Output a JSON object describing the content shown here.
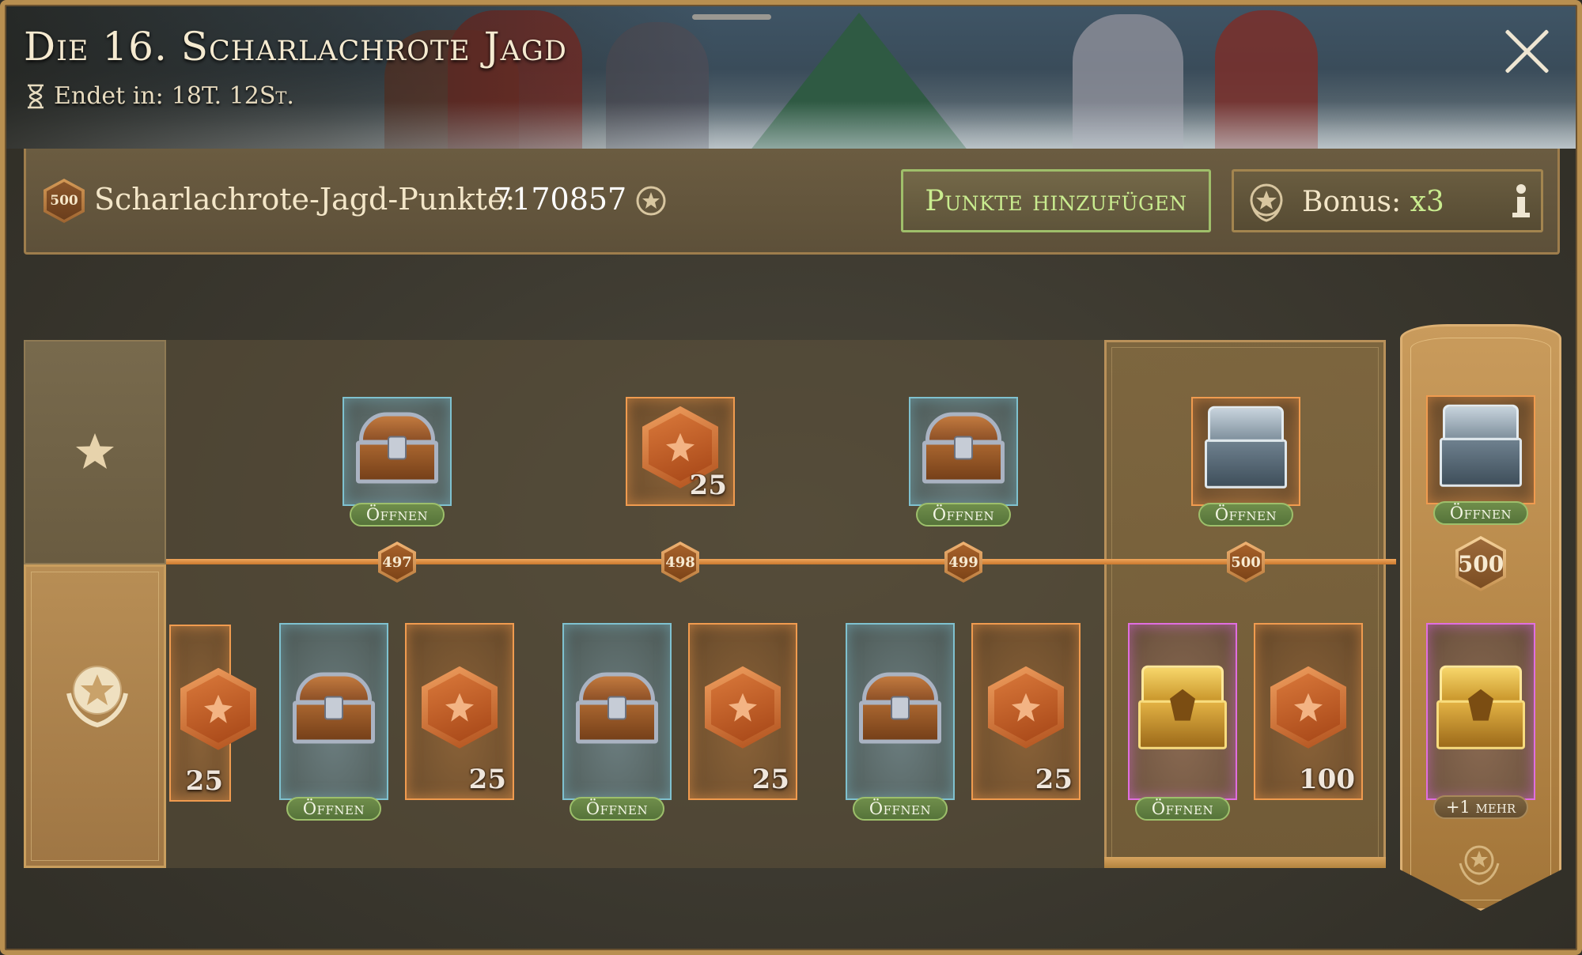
{
  "header": {
    "title": "Die 16. Scharlachrote Jagd",
    "timer_label": "Endet in:",
    "timer_value": "18T. 12St."
  },
  "points": {
    "badge_level": "500",
    "label": "Scharlachrote-Jagd-Punkte:",
    "value": "7170857",
    "add_button": "Punkte hinzufügen",
    "bonus_label": "Bonus:",
    "bonus_value": "x3"
  },
  "colors": {
    "accent_green": "#c9ec8f",
    "track_orange": "#e08a3c",
    "card_blue": "#7fc1cf",
    "card_orange": "#f09b4f",
    "card_pink": "#e06ee0"
  },
  "track": {
    "levels": [
      {
        "level": "497",
        "free": {
          "type": "wooden-chest",
          "rarity": "blue",
          "action": "Öffnen"
        },
        "premium": [
          {
            "type": "wooden-chest",
            "rarity": "blue",
            "action": "Öffnen"
          },
          {
            "type": "token",
            "rarity": "orange",
            "qty": "25"
          }
        ]
      },
      {
        "level": "498",
        "free": {
          "type": "token",
          "rarity": "orange",
          "qty": "25"
        },
        "premium": [
          {
            "type": "wooden-chest",
            "rarity": "blue",
            "action": "Öffnen"
          },
          {
            "type": "token",
            "rarity": "orange",
            "qty": "25"
          }
        ]
      },
      {
        "level": "499",
        "free": {
          "type": "wooden-chest",
          "rarity": "blue",
          "action": "Öffnen"
        },
        "premium": [
          {
            "type": "wooden-chest",
            "rarity": "blue",
            "action": "Öffnen"
          },
          {
            "type": "token",
            "rarity": "orange",
            "qty": "25"
          }
        ]
      },
      {
        "level": "500",
        "free": {
          "type": "silver-chest",
          "rarity": "orange",
          "action": "Öffnen"
        },
        "premium": [
          {
            "type": "gold-chest",
            "rarity": "pink",
            "action": "Öffnen"
          },
          {
            "type": "token",
            "rarity": "orange",
            "qty": "100"
          }
        ]
      }
    ],
    "partial_premium_qty": "25",
    "final": {
      "level": "500",
      "free_action": "Öffnen",
      "more_label": "+1 mehr"
    }
  },
  "icons": {
    "free_tier": "star-icon",
    "premium_tier": "laurel-medal-icon",
    "timer": "hourglass-icon",
    "close": "close-icon",
    "info": "info-icon"
  }
}
